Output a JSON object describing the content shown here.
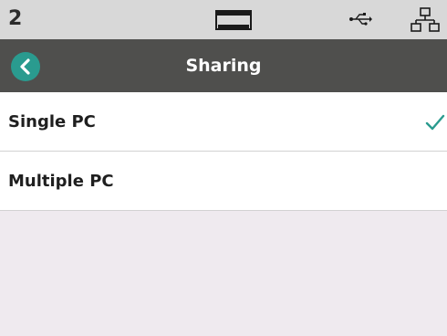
{
  "status": {
    "number": "2",
    "icons": [
      "display-icon",
      "usb-icon",
      "network-icon"
    ]
  },
  "header": {
    "title": "Sharing",
    "back_icon": "chevron-left-icon"
  },
  "options": [
    {
      "label": "Single PC",
      "selected": true
    },
    {
      "label": "Multiple PC",
      "selected": false
    }
  ],
  "colors": {
    "accent": "#2a9b8f",
    "title_bar": "#4f4f4d",
    "status_bar": "#d8d8d8",
    "background": "#efeaef"
  }
}
